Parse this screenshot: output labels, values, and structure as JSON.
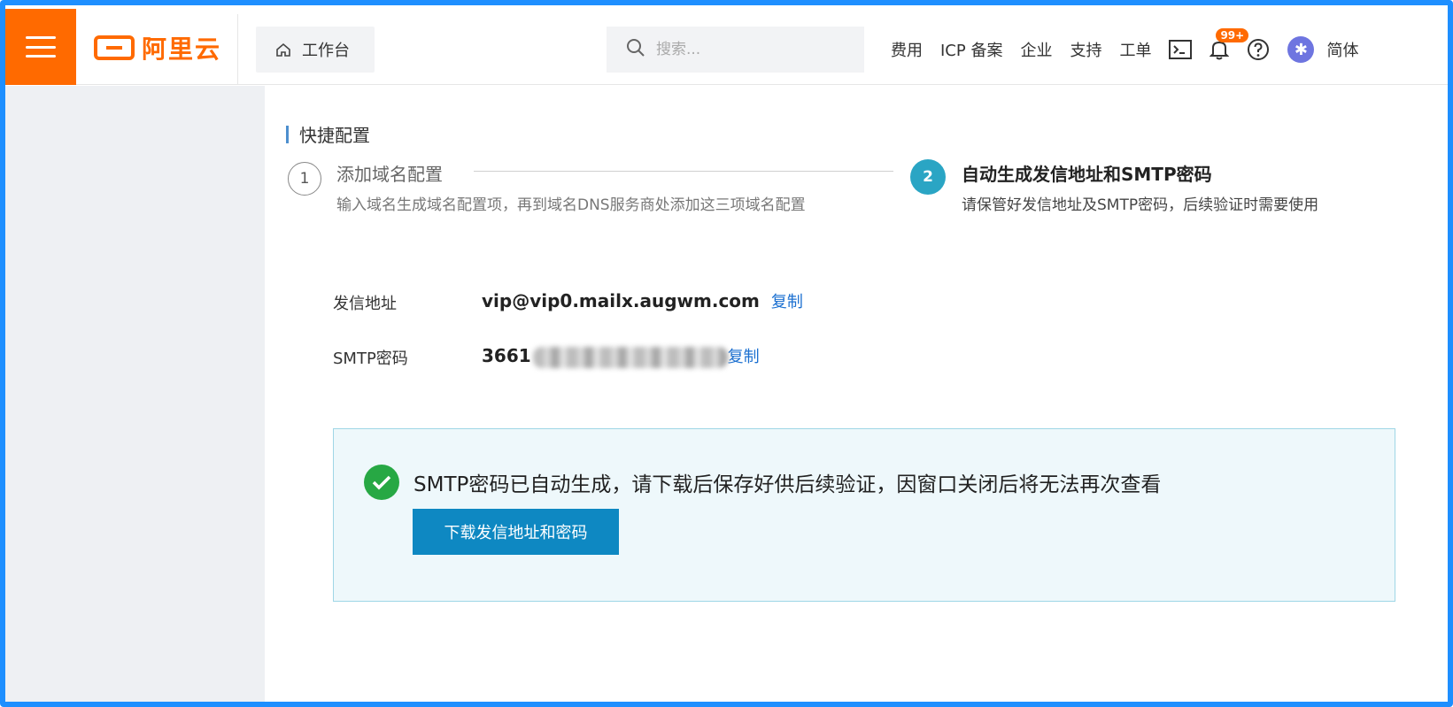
{
  "header": {
    "logo_text": "阿里云",
    "workbench_label": "工作台",
    "search_placeholder": "搜索...",
    "nav": [
      "费用",
      "ICP 备案",
      "企业",
      "支持",
      "工单"
    ],
    "notification_badge": "99+",
    "lang": "简体"
  },
  "section": {
    "title": "快捷配置"
  },
  "steps": [
    {
      "number": "1",
      "title": "添加域名配置",
      "desc": "输入域名生成域名配置项，再到域名DNS服务商处添加这三项域名配置"
    },
    {
      "number": "2",
      "title": "自动生成发信地址和SMTP密码",
      "desc": "请保管好发信地址及SMTP密码，后续验证时需要使用"
    }
  ],
  "fields": {
    "sender_label": "发信地址",
    "sender_value": "vip@vip0.mailx.augwm.com",
    "sender_copy": "复制",
    "smtp_label": "SMTP密码",
    "smtp_value_prefix": "3661",
    "smtp_copy": "复制"
  },
  "notice": {
    "message": "SMTP密码已自动生成，请下载后保存好供后续验证，因窗口关闭后将无法再次查看",
    "download_button": "下载发信地址和密码"
  },
  "colors": {
    "brand": "#ff6a00",
    "step_active": "#2aa5c4",
    "link": "#1a6fd0",
    "button": "#0e88c2",
    "success": "#27a844",
    "frame": "#1e8fff"
  }
}
